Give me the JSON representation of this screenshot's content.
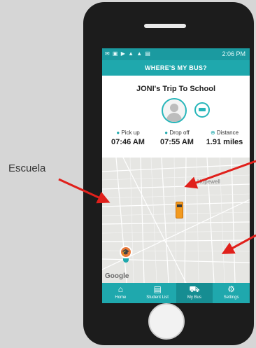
{
  "annotation": {
    "school_label": "Escuela"
  },
  "statusbar": {
    "time": "2:06 PM",
    "icons": "✉ ▣ ▶ ▲ ▲ ▤"
  },
  "appbar": {
    "title": "WHERE'S MY BUS?"
  },
  "trip": {
    "title": "JONI's Trip To School",
    "pickup": {
      "label": "Pick up",
      "time": "07:46 AM"
    },
    "dropoff": {
      "label": "Drop off",
      "time": "07:55 AM"
    },
    "distance": {
      "label": "Distance",
      "value": "1.91 miles"
    }
  },
  "map": {
    "place": "Hopewell",
    "attribution": "Google"
  },
  "tabs": [
    {
      "label": "Home",
      "icon": "home-icon"
    },
    {
      "label": "Student List",
      "icon": "clipboard-icon"
    },
    {
      "label": "My Bus",
      "icon": "bus-icon",
      "active": true
    },
    {
      "label": "Settings",
      "icon": "gear-icon"
    }
  ],
  "colors": {
    "teal": "#1fa8ad",
    "orange": "#ea7b3c",
    "arrow": "#e0201b"
  }
}
